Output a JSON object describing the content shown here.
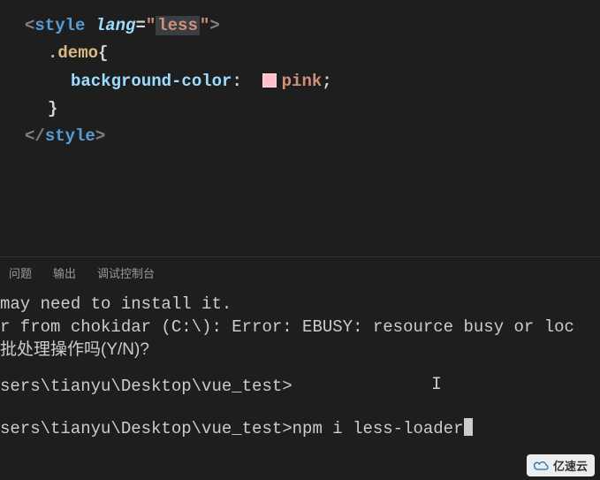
{
  "code": {
    "open_bracket": "<",
    "style_tag": "style",
    "space": " ",
    "lang_attr": "lang",
    "equals": "=",
    "quote": "\"",
    "lang_value": "less",
    "close_bracket": ">",
    "selector": ".demo",
    "open_brace": "{",
    "property": "background-color",
    "colon": ":",
    "value": "pink",
    "semicolon": ";",
    "close_brace": "}",
    "close_open": "</",
    "color_hex": "#ffc0cb"
  },
  "tabs": {
    "problems": "问题",
    "output": "输出",
    "debug_console": "调试控制台"
  },
  "terminal": {
    "line1": "may need to install it.",
    "line2": "r from chokidar (C:\\): Error: EBUSY: resource busy or loc",
    "line3": "批处理操作吗(Y/N)?",
    "prompt1": "sers\\tianyu\\Desktop\\vue_test>",
    "prompt2": "sers\\tianyu\\Desktop\\vue_test>",
    "command": "npm i less-loader"
  },
  "watermark": {
    "text": "亿速云"
  }
}
